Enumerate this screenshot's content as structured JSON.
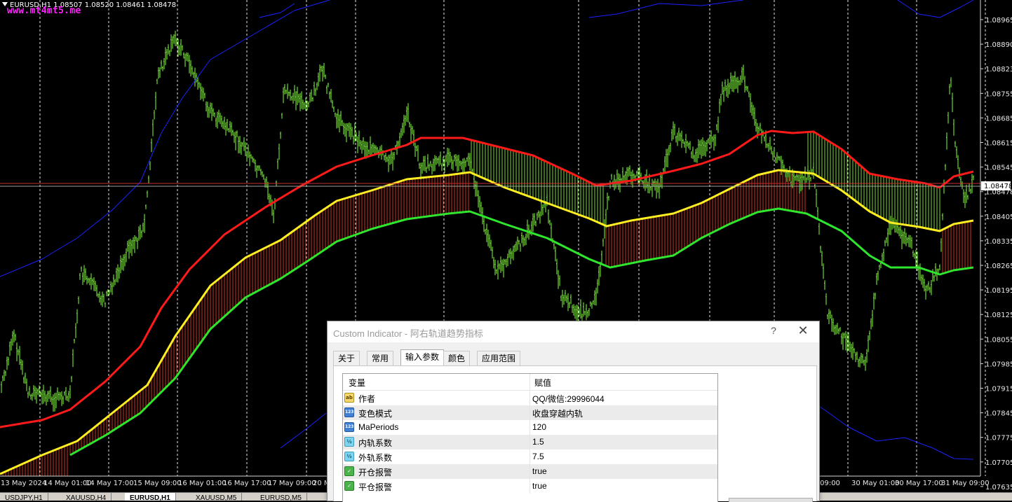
{
  "chart": {
    "header": "EURUSD,H1  1.08507 1.08520 1.08461 1.08478",
    "watermark": "www.mt4mt5.me",
    "price_labels": [
      "1.08965",
      "1.08890",
      "1.08823",
      "1.08755",
      "1.08685",
      "1.08615",
      "1.08545",
      "1.08478",
      "1.08405",
      "1.08335",
      "1.08265",
      "1.08195",
      "1.08125",
      "1.08055",
      "1.07985",
      "1.07915",
      "1.07845",
      "1.07775",
      "1.07705",
      "1.07635"
    ],
    "current_price": "1.08478",
    "time_labels": [
      "13 May 2024",
      "14 May 01:00",
      "14 May 17:00",
      "15 May 09:00",
      "16 May 01:00",
      "16 May 17:00",
      "17 May 09:00",
      "20 M",
      "y 09:00",
      "30 May 01:00",
      "30 May 17:00",
      "31 May 09:00"
    ],
    "colors": {
      "up": "#7fff3a",
      "outer_upper": "#ff1a1a",
      "middle": "#ffee22",
      "inner_lower": "#2ee62e",
      "band": "#1a22ff",
      "fill_bear": "#d2321a",
      "fill_bull": "#7cdc28"
    }
  },
  "tabs": [
    "USDJPY,H1",
    "XAUUSD,H4",
    "EURUSD,H1",
    "XAUUSD,M5",
    "EURUSD,M5"
  ],
  "active_tab": "EURUSD,H1",
  "dialog": {
    "title": "Custom Indicator - 阿右轨道趋势指标",
    "help": "?",
    "close": "✕",
    "tabs": [
      "关于",
      "常用",
      "输入参数",
      "颜色",
      "应用范围"
    ],
    "active_tab": "输入参数",
    "columns": [
      "变量",
      "赋值"
    ],
    "rows": [
      {
        "icon": "ab",
        "name": "作者",
        "value": "QQ/微信:29996044"
      },
      {
        "icon": "123",
        "name": "变色模式",
        "value": "收盘穿越内轨"
      },
      {
        "icon": "123",
        "name": "MaPeriods",
        "value": "120"
      },
      {
        "icon": "v2",
        "name": "内轨系数",
        "value": "1.5"
      },
      {
        "icon": "v2",
        "name": "外轨系数",
        "value": "7.5"
      },
      {
        "icon": "bool",
        "name": "开仓报警",
        "value": "true"
      },
      {
        "icon": "bool",
        "name": "平仓报警",
        "value": "true"
      }
    ]
  }
}
